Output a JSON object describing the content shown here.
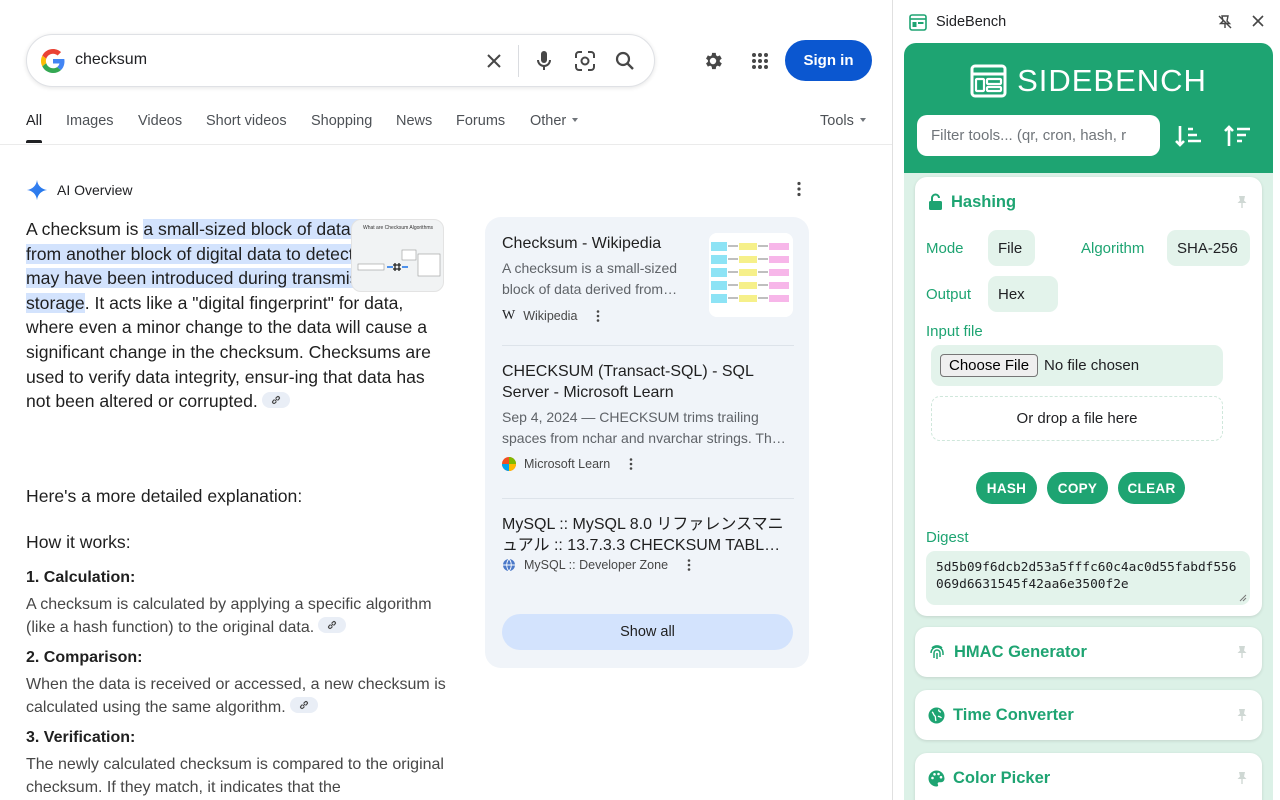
{
  "search": {
    "query": "checksum",
    "sign_in": "Sign in",
    "tabs": [
      "All",
      "Images",
      "Videos",
      "Short videos",
      "Shopping",
      "News",
      "Forums",
      "Other",
      "Tools"
    ]
  },
  "overview": {
    "label": "AI Overview",
    "p1_pre": "A checksum is ",
    "p1_hl": "a small-sized block of data derived from another block of digital data to detect errors that may have been introduced during transmis-sion or storage",
    "p1_post": ". It acts like a \"digital fingerprint\" for data, where even a minor change to the data will cause a significant change in the checksum. Checksums are used to verify data integrity, ensur-ing that data has not been altered or corrupted.",
    "more": "Here's a more detailed explanation:",
    "how": "How it works:",
    "steps": [
      {
        "title": "1. Calculation:",
        "body": "A checksum is calculated by applying a specific algorithm (like a hash function) to the original data."
      },
      {
        "title": "2. Comparison:",
        "body": "When the data is received or accessed, a new checksum is calculated using the same algorithm."
      },
      {
        "title": "3. Verification:",
        "body": "The newly calculated checksum is compared to the original checksum. If they match, it indicates that the"
      }
    ],
    "thumb_caption": "What are Checksum Algorithms"
  },
  "sources": [
    {
      "title": "Checksum - Wikipedia",
      "snippet": "A checksum is a small-sized block of data derived from…",
      "site": "Wikipedia"
    },
    {
      "title": "CHECKSUM (Transact-SQL) - SQL Server - Microsoft Learn",
      "snippet": "Sep 4, 2024 — CHECKSUM trims trailing spaces from nchar and nvarchar strings. Th…",
      "site": "Microsoft Learn"
    },
    {
      "title": "MySQL :: MySQL 8.0 リファレンスマニュアル :: 13.7.3.3 CHECKSUM TABL…",
      "site": "MySQL :: Developer Zone"
    }
  ],
  "show_all": "Show all",
  "sidepanel": {
    "title": "SideBench",
    "brand": "SIDEBENCH",
    "filter_placeholder": "Filter tools... (qr, cron, hash, r",
    "hashing": {
      "title": "Hashing",
      "mode_label": "Mode",
      "mode_value": "File",
      "algorithm_label": "Algorithm",
      "algorithm_value": "SHA-256",
      "output_label": "Output",
      "output_value": "Hex",
      "input_label": "Input file",
      "choose_file": "Choose File",
      "no_file": "No file chosen",
      "drop": "Or drop a file here",
      "btn_hash": "HASH",
      "btn_copy": "COPY",
      "btn_clear": "CLEAR",
      "digest_label": "Digest",
      "digest_value": "5d5b09f6dcb2d53a5fffc60c4ac0d55fabdf556069d6631545f42aa6e3500f2e"
    },
    "tools": [
      "HMAC Generator",
      "Time Converter",
      "Color Picker"
    ],
    "accent": "#1ea472"
  }
}
